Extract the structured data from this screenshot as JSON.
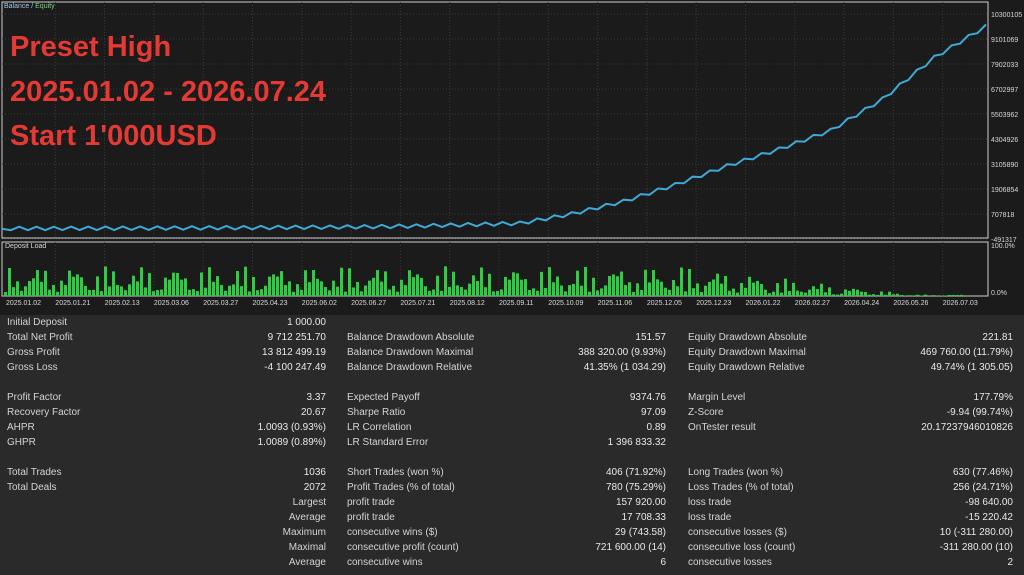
{
  "overlay": {
    "line1": "Preset High",
    "line2": "2025.01.02 - 2026.07.24",
    "line3": "Start 1'000USD",
    "color": "#e53a34"
  },
  "legend": {
    "balance": "Balance",
    "sep": " / ",
    "equity": "Equity"
  },
  "deposit_label": "Deposit Load",
  "colors": {
    "balance_line": "#3fa9d6",
    "equity_line": "#2fb4c8",
    "deposit_bars": "#2ecc40",
    "background": "#1b1b1b"
  },
  "chart_data": [
    {
      "type": "line",
      "series": [
        {
          "name": "Balance / Equity"
        }
      ],
      "x": [
        "2025.01.02",
        "2025.01.21",
        "2025.02.13",
        "2025.03.06",
        "2025.03.27",
        "2025.04.23",
        "2025.06.02",
        "2025.06.27",
        "2025.07.21",
        "2025.08.12",
        "2025.09.11",
        "2025.10.09",
        "2025.11.06",
        "2025.12.05",
        "2025.12.23",
        "2026.01.22",
        "2026.02.27",
        "2026.04.24",
        "2026.05.26",
        "2026.07.03"
      ],
      "values": [
        1000,
        5000,
        12000,
        20000,
        30000,
        45000,
        60000,
        80000,
        120000,
        180000,
        250000,
        700000,
        1300000,
        2100000,
        3000000,
        3800000,
        4700000,
        6200000,
        8200000,
        9700000
      ],
      "ylim": [
        -491317,
        10300105
      ],
      "y_ticks": [
        "10300105",
        "9101069",
        "7902033",
        "6702997",
        "5503962",
        "4304926",
        "3105890",
        "1906854",
        "707818",
        "-491317"
      ]
    },
    {
      "type": "bar",
      "title": "Deposit Load",
      "ylim": [
        0,
        100
      ],
      "y_ticks": [
        "100.0%",
        "0.0%"
      ]
    }
  ],
  "x_ticks": [
    "2025.01.02",
    "2025.01.21",
    "2025.02.13",
    "2025.03.06",
    "2025.03.27",
    "2025.04.23",
    "2025.06.02",
    "2025.06.27",
    "2025.07.21",
    "2025.08.12",
    "2025.09.11",
    "2025.10.09",
    "2025.11.06",
    "2025.12.05",
    "2025.12.23",
    "2026.01.22",
    "2026.02.27",
    "2026.04.24",
    "2026.05.26",
    "2026.07.03"
  ],
  "stats": {
    "initial_deposit": {
      "label": "Initial Deposit",
      "value": "1 000.00"
    },
    "col1": [
      {
        "label": "Total Net Profit",
        "value": "9 712 251.70"
      },
      {
        "label": "Gross Profit",
        "value": "13 812 499.19"
      },
      {
        "label": "Gross Loss",
        "value": "-4 100 247.49"
      },
      {
        "label": "Profit Factor",
        "value": "3.37"
      },
      {
        "label": "Recovery Factor",
        "value": "20.67"
      },
      {
        "label": "AHPR",
        "value": "1.0093 (0.93%)"
      },
      {
        "label": "GHPR",
        "value": "1.0089 (0.89%)"
      },
      {
        "label": "Total Trades",
        "value": "1036"
      },
      {
        "label": "Total Deals",
        "value": "2072"
      }
    ],
    "col2": [
      {
        "label": "Balance Drawdown Absolute",
        "value": "151.57"
      },
      {
        "label": "Balance Drawdown Maximal",
        "value": "388 320.00 (9.93%)"
      },
      {
        "label": "Balance Drawdown Relative",
        "value": "41.35% (1 034.29)"
      },
      {
        "label": "Expected Payoff",
        "value": "9374.76"
      },
      {
        "label": "Sharpe Ratio",
        "value": "97.09"
      },
      {
        "label": "LR Correlation",
        "value": "0.89"
      },
      {
        "label": "LR Standard Error",
        "value": "1 396 833.32"
      },
      {
        "label": "Short Trades (won %)",
        "value": "406 (71.92%)"
      },
      {
        "label": "Profit Trades (% of total)",
        "value": "780 (75.29%)"
      }
    ],
    "col3": [
      {
        "label": "Equity Drawdown Absolute",
        "value": "221.81"
      },
      {
        "label": "Equity Drawdown Maximal",
        "value": "469 760.00 (11.79%)"
      },
      {
        "label": "Equity Drawdown Relative",
        "value": "49.74% (1 305.05)"
      },
      {
        "label": "Margin Level",
        "value": "177.79%"
      },
      {
        "label": "Z-Score",
        "value": "-9.94 (99.74%)"
      },
      {
        "label": "OnTester result",
        "value": "20.17237946010826"
      },
      {
        "label": "",
        "value": ""
      },
      {
        "label": "Long Trades (won %)",
        "value": "630 (77.46%)"
      },
      {
        "label": "Loss Trades (% of total)",
        "value": "256 (24.71%)"
      }
    ],
    "extra": [
      {
        "k": "Largest",
        "l2": "profit trade",
        "v2": "157 920.00",
        "l3": "loss trade",
        "v3": "-98 640.00"
      },
      {
        "k": "Average",
        "l2": "profit trade",
        "v2": "17 708.33",
        "l3": "loss trade",
        "v3": "-15 220.42"
      },
      {
        "k": "Maximum",
        "l2": "consecutive wins ($)",
        "v2": "29 (743.58)",
        "l3": "consecutive losses ($)",
        "v3": "10 (-311 280.00)"
      },
      {
        "k": "Maximal",
        "l2": "consecutive profit (count)",
        "v2": "721 600.00 (14)",
        "l3": "consecutive loss (count)",
        "v3": "-311 280.00 (10)"
      },
      {
        "k": "Average",
        "l2": "consecutive wins",
        "v2": "6",
        "l3": "consecutive losses",
        "v3": "2"
      }
    ]
  }
}
